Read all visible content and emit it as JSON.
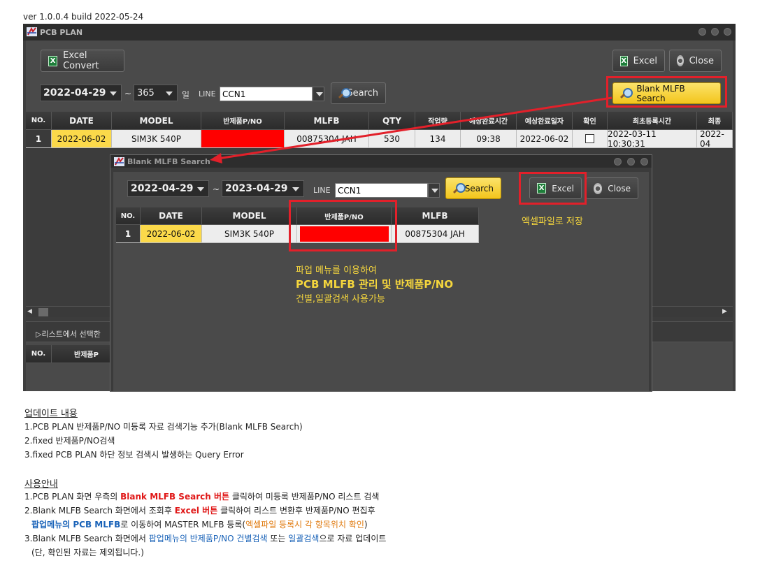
{
  "version_text": "ver 1.0.0.4 build 2022-05-24",
  "app": {
    "title": "PCB PLAN",
    "excel_convert_label": "Excel Convert",
    "excel_label": "Excel",
    "close_label": "Close",
    "date_from": "2022-04-29",
    "days_sep": "~",
    "days_value": "365",
    "days_unit": "일",
    "line_label": "LINE",
    "line_value": "CCN1",
    "search_label": "Search",
    "blank_mlfb_label": "Blank MLFB Search",
    "grid_headers": [
      "NO.",
      "DATE",
      "MODEL",
      "반제품P/NO",
      "MLFB",
      "QTY",
      "작업량",
      "예상완료시간",
      "예상완료일자",
      "확인",
      "최초등록시간",
      "최종"
    ],
    "grid_rows": [
      {
        "no": "1",
        "date": "2022-06-02",
        "model": "SIM3K 540P",
        "pno": "",
        "mlfb": "00875304 JAH",
        "qty": "530",
        "work": "134",
        "eta_time": "09:38",
        "eta_date": "2022-06-02",
        "confirm": false,
        "first_reg": "2022-03-11 10:30:31",
        "last": "2022-04"
      }
    ],
    "bottom_section_label": "▷리스트에서 선택한",
    "bottom_headers": [
      "NO.",
      "반제품P"
    ]
  },
  "popup": {
    "title": "Blank MLFB Search",
    "date_from": "2022-04-29",
    "sep": "~",
    "date_to": "2023-04-29",
    "line_label": "LINE",
    "line_value": "CCN1",
    "search_label": "Search",
    "excel_label": "Excel",
    "close_label": "Close",
    "headers": [
      "NO.",
      "DATE",
      "MODEL",
      "반제품P/NO",
      "MLFB"
    ],
    "rows": [
      {
        "no": "1",
        "date": "2022-06-02",
        "model": "SIM3K 540P",
        "pno": "",
        "mlfb": "00875304 JAH"
      }
    ],
    "annot_excel": "엑셀파일로 저장",
    "annot_line1": "파업 메뉴를 이용하여",
    "annot_line2": "PCB MLFB 관리 및 반제품P/NO",
    "annot_line3": "건별,일괄검색 사용가능"
  },
  "notes": {
    "update_title": "업데이트 내용",
    "update_items": [
      "1.PCB PLAN 반제품P/NO 미등록 자료 검색기능 추가(Blank MLFB Search)",
      "2.fixed 반제품P/NO검색",
      "3.fixed PCB PLAN 하단 정보 검색시 발생하는 Query Error"
    ],
    "guide_title": "사용안내",
    "g1_a": "1.PCB PLAN 화면 우측의 ",
    "g1_b": "Blank MLFB Search 버튼",
    "g1_c": " 클릭하여 미등록 반제품P/NO 리스트 검색",
    "g2_a": "2.Blank MLFB Search 화면에서 조회후 ",
    "g2_b": "Excel 버튼",
    "g2_c": " 클릭하여 리스트 변환후 반제품P/NO 편집후",
    "g2b_a": "팝업메뉴의 PCB MLFB",
    "g2b_b": "로 이동하여 MASTER MLFB 등록(",
    "g2b_c": "엑셀파일 등록시 각 항목위치 확인",
    "g2b_d": ")",
    "g3_a": "3.Blank MLFB Search 화면에서 ",
    "g3_b": "팝업메뉴의 반제품P/NO 건별검색",
    "g3_c": " 또는 ",
    "g3_d": "일괄검색",
    "g3_e": "으로 자료 업데이트",
    "g4": "(단, 확인된 자료는 제외됩니다.)"
  },
  "colors": {
    "highlight_red": "#e2202a",
    "date_cell_yellow": "#fbd94a",
    "blank_cell_red": "#ff0000",
    "button_yellow": "#f3c51c"
  }
}
